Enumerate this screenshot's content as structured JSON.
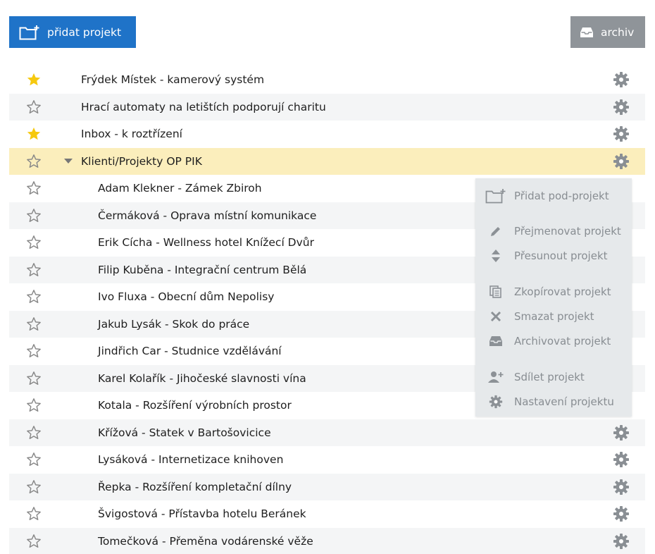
{
  "toolbar": {
    "add_label": "přidat projekt",
    "archive_label": "archiv"
  },
  "colors": {
    "primary": "#1f73c8",
    "archive": "#8f9499",
    "star_active": "#f6c90e",
    "active_row": "#fbeebc",
    "menu_bg": "#e6e9eb"
  },
  "projects": [
    {
      "label": "Frýdek Místek - kamerový systém",
      "starred": true,
      "level": 0
    },
    {
      "label": "Hrací automaty na letištích podporují charitu",
      "starred": false,
      "level": 0
    },
    {
      "label": "Inbox - k roztřízení",
      "starred": true,
      "level": 0
    },
    {
      "label": "Klienti/Projekty OP PIK",
      "starred": false,
      "level": 0,
      "expanded": true,
      "active": true
    },
    {
      "label": "Adam Klekner - Zámek Zbiroh",
      "starred": false,
      "level": 1
    },
    {
      "label": "Čermáková - Oprava místní komunikace",
      "starred": false,
      "level": 1
    },
    {
      "label": "Erik Cícha - Wellness hotel Knížecí Dvůr",
      "starred": false,
      "level": 1
    },
    {
      "label": "Filip Kuběna - Integrační centrum Bělá",
      "starred": false,
      "level": 1
    },
    {
      "label": "Ivo Fluxa - Obecní dům Nepolisy",
      "starred": false,
      "level": 1
    },
    {
      "label": "Jakub Lysák - Skok do práce",
      "starred": false,
      "level": 1
    },
    {
      "label": "Jindřich Car - Studnice vzdělávání",
      "starred": false,
      "level": 1
    },
    {
      "label": "Karel Kolařík - Jihočeské slavnosti vína",
      "starred": false,
      "level": 1
    },
    {
      "label": "Kotala - Rozšíření výrobních prostor",
      "starred": false,
      "level": 1
    },
    {
      "label": "Křížová - Statek v Bartošovicice",
      "starred": false,
      "level": 1
    },
    {
      "label": "Lysáková - Internetizace knihoven",
      "starred": false,
      "level": 1
    },
    {
      "label": "Řepka - Rozšíření kompletační dílny",
      "starred": false,
      "level": 1
    },
    {
      "label": "Švigostová - Přístavba hotelu Beránek",
      "starred": false,
      "level": 1
    },
    {
      "label": "Tomečková - Přeměna vodárenské věže",
      "starred": false,
      "level": 1
    }
  ],
  "context_menu": {
    "items": [
      {
        "label": "Přidat pod-projekt",
        "icon": "folder-plus-icon"
      },
      {
        "label": "Přejmenovat projekt",
        "icon": "pencil-icon"
      },
      {
        "label": "Přesunout projekt",
        "icon": "move-updown-icon"
      },
      {
        "label": "Zkopírovat projekt",
        "icon": "copy-icon"
      },
      {
        "label": "Smazat projekt",
        "icon": "delete-x-icon"
      },
      {
        "label": "Archivovat projekt",
        "icon": "archive-icon"
      },
      {
        "label": "Sdílet projekt",
        "icon": "share-user-icon"
      },
      {
        "label": "Nastavení projektu",
        "icon": "gear-icon"
      }
    ]
  }
}
